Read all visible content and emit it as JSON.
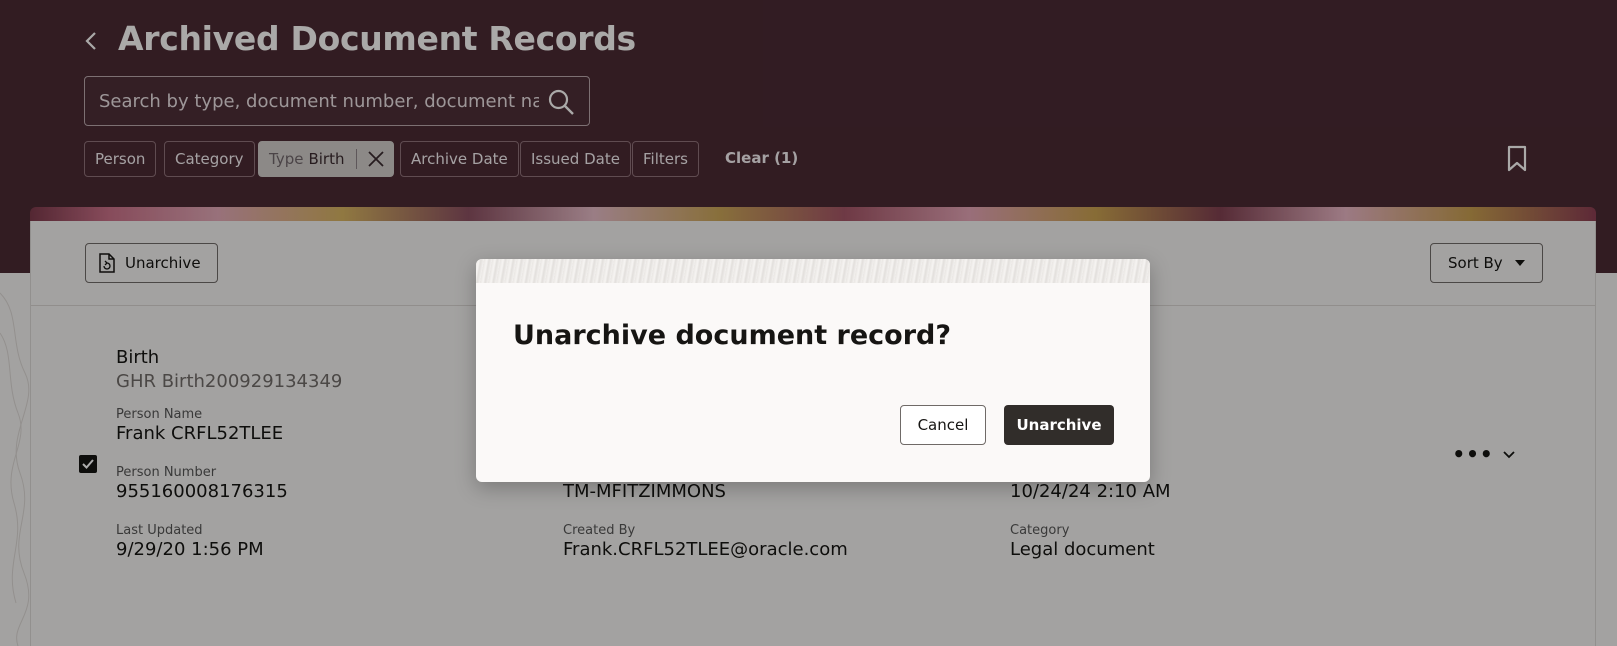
{
  "header": {
    "title": "Archived Document Records",
    "search_placeholder": "Search by type, document number, document name, or issuing authority",
    "filters": [
      {
        "label": "Person"
      },
      {
        "label": "Category"
      },
      {
        "label": "Type",
        "value": "Birth",
        "active": true
      },
      {
        "label": "Archive Date"
      },
      {
        "label": "Issued Date"
      },
      {
        "label": "Filters"
      }
    ],
    "clear_label": "Clear (1)"
  },
  "toolbar": {
    "unarchive_label": "Unarchive",
    "sort_label": "Sort By"
  },
  "record": {
    "title": "Birth",
    "subtitle": "GHR Birth200929134349",
    "selected": true,
    "col1": [
      {
        "label": "Person Name",
        "value": "Frank CRFL52TLEE"
      },
      {
        "label": "Person Number",
        "value": "955160008176315"
      },
      {
        "label": "Last Updated",
        "value": "9/29/20 1:56 PM"
      }
    ],
    "col2": [
      {
        "value": "TM-MFITZIMMONS"
      },
      {
        "label": "Created By",
        "value": "Frank.CRFL52TLEE@oracle.com"
      }
    ],
    "col3": [
      {
        "value": "10/24/24 2:10 AM"
      },
      {
        "label": "Category",
        "value": "Legal document"
      }
    ],
    "more_label": "•••"
  },
  "dialog": {
    "title": "Unarchive document record?",
    "cancel_label": "Cancel",
    "confirm_label": "Unarchive"
  },
  "colors": {
    "header_bg": "#4a2a33",
    "primary_button": "#312d2a"
  }
}
